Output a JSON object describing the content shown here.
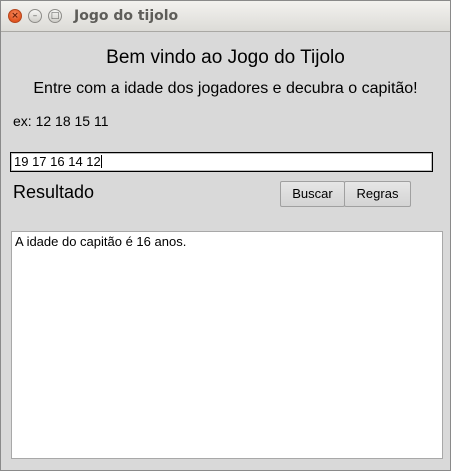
{
  "window": {
    "title": "Jogo do tijolo",
    "close_glyph": "×",
    "minimize_glyph": "–",
    "maximize_glyph": "□"
  },
  "main": {
    "welcome": "Bem vindo ao Jogo do Tijolo",
    "instructions": "Entre com a idade dos jogadores e decubra o capitão!",
    "example": "ex: 12 18 15 11",
    "ages_input_value": "19 17 16 14 12",
    "result_label": "Resultado",
    "search_button": "Buscar",
    "rules_button": "Regras",
    "result_text": "A idade do capitão é 16 anos."
  }
}
